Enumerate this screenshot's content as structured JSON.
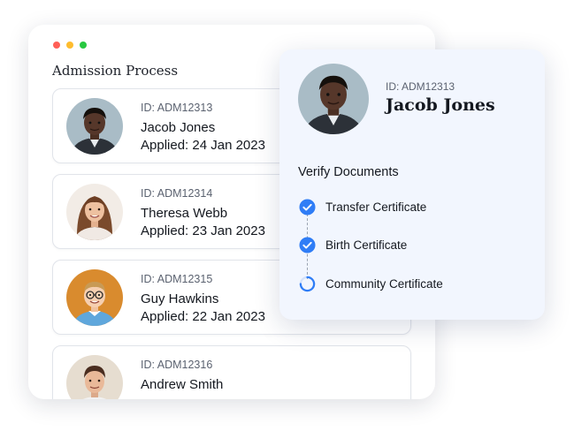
{
  "window": {
    "dots": [
      "#ff5f57",
      "#febc2e",
      "#28c840"
    ],
    "title": "Admission Process"
  },
  "applicants": [
    {
      "id": "ID: ADM12313",
      "name": "Jacob Jones",
      "applied": "Applied: 24 Jan 2023"
    },
    {
      "id": "ID: ADM12314",
      "name": "Theresa Webb",
      "applied": "Applied: 23 Jan 2023"
    },
    {
      "id": "ID: ADM12315",
      "name": "Guy Hawkins",
      "applied": "Applied: 22 Jan 2023"
    },
    {
      "id": "ID: ADM12316",
      "name": "Andrew Smith",
      "applied": ""
    }
  ],
  "detail": {
    "id": "ID: ADM12313",
    "name": "Jacob Jones",
    "verify_title": "Verify Documents",
    "documents": [
      {
        "label": "Transfer Certificate",
        "status": "verified",
        "icon": "check-circle-icon"
      },
      {
        "label": "Birth Certificate",
        "status": "verified",
        "icon": "check-circle-icon"
      },
      {
        "label": "Community Certificate",
        "status": "in-progress",
        "icon": "spinner-icon"
      }
    ]
  },
  "colors": {
    "accent": "#2f7df6"
  }
}
